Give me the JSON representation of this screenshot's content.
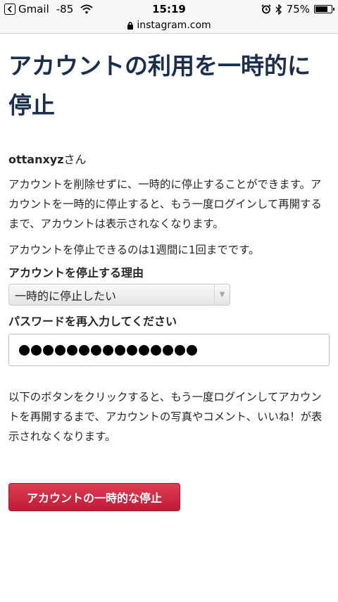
{
  "status_bar": {
    "app": "Gmail",
    "signal": "-85",
    "time": "15:19",
    "battery": "75%",
    "battery_level": 0.75
  },
  "url_bar": {
    "domain": "instagram.com"
  },
  "page": {
    "title": "アカウントの利用を一時的に停止",
    "username": "ottanxyz",
    "username_suffix": "さん",
    "paragraph1": "アカウントを削除せずに、一時的に停止することができます。アカウントを一時的に停止すると、もう一度ログインして再開するまで、アカウントは表示されなくなります。",
    "paragraph2": "アカウントを停止できるのは1週間に1回までです。",
    "reason_label": "アカウントを停止する理由",
    "reason_selected": "一時的に停止したい",
    "password_label": "パスワードを再入力してください",
    "password_length": 15,
    "paragraph3": "以下のボタンをクリックすると、もう一度ログインしてアカウントを再開するまで、アカウントの写真やコメント、いいね！が表示されなくなります。",
    "submit_button": "アカウントの一時的な停止"
  },
  "colors": {
    "title": "#1b2e4b",
    "button": "#c81f3d"
  },
  "icons": {
    "back": "back-arrow-icon",
    "wifi": "wifi-icon",
    "lock": "lock-icon",
    "alarm": "alarm-icon",
    "bluetooth": "bluetooth-icon",
    "battery": "battery-icon",
    "dropdown": "chevron-down-icon"
  }
}
